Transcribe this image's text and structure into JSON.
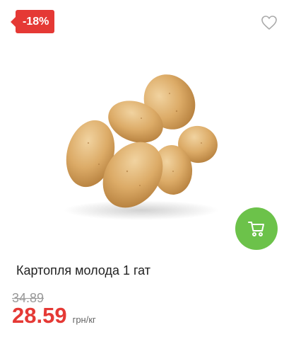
{
  "badge": {
    "discount": "-18%"
  },
  "product": {
    "title": "Картопля молода 1 гат",
    "old_price": "34.89",
    "new_price": "28.59",
    "unit": "грн/кг"
  },
  "colors": {
    "accent_red": "#e53935",
    "cart_green": "#6cc24a"
  },
  "icons": {
    "wishlist": "heart-outline-icon",
    "cart": "cart-icon"
  }
}
